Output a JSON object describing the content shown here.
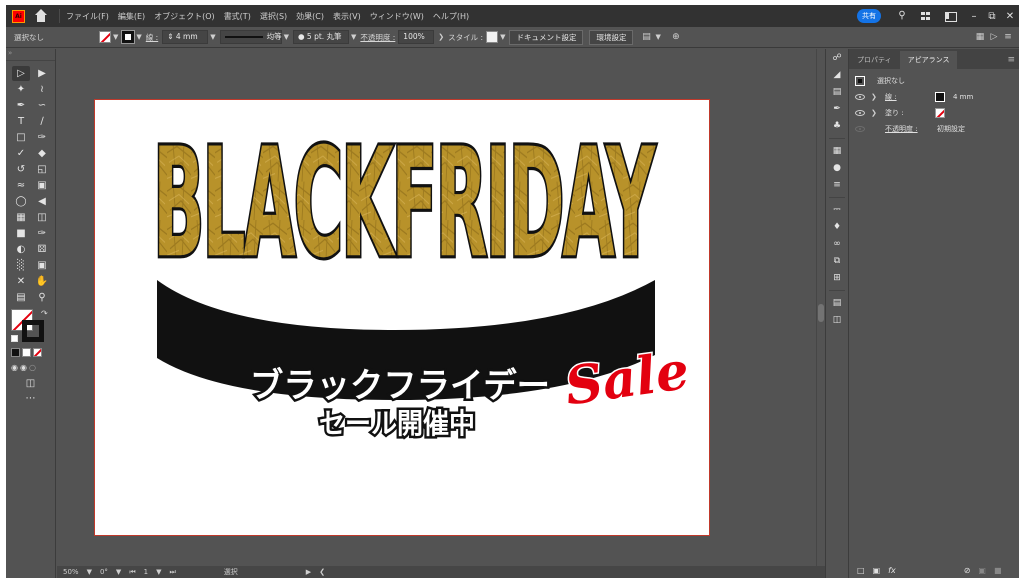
{
  "menubar": {
    "logo": "Ai",
    "items": [
      "ファイル(F)",
      "編集(E)",
      "オブジェクト(O)",
      "書式(T)",
      "選択(S)",
      "効果(C)",
      "表示(V)",
      "ウィンドウ(W)",
      "ヘルプ(H)"
    ],
    "share": "共有"
  },
  "controlbar": {
    "selection": "選択なし",
    "stroke_label": "線 :",
    "stroke_weight": "4 mm",
    "profile": "均等",
    "brush": "5 pt. 丸筆",
    "opacity_label": "不透明度 :",
    "opacity": "100%",
    "style_label": "スタイル :",
    "document_setup": "ドキュメント設定",
    "preferences": "環境設定"
  },
  "artwork": {
    "headline": "BLACKFRIDAY",
    "subtitle": "ブラックフライデー",
    "subtitle2": "セール開催中",
    "script": "Sale",
    "gold": "#b8922a",
    "red": "#e3000f"
  },
  "panel": {
    "tabs": [
      "プロパティ",
      "アピアランス"
    ],
    "object": "選択なし",
    "stroke_label": "線 :",
    "stroke_value": "4 mm",
    "fill_label": "塗り :",
    "opacity_label": "不透明度 :",
    "opacity_value": "初期設定"
  },
  "statusbar": {
    "zoom": "50%",
    "rotation": "0°",
    "artboard": "1",
    "tool": "選択"
  }
}
